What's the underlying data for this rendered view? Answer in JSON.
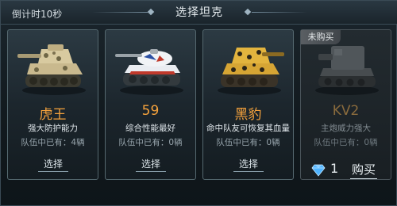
{
  "header": {
    "countdown": "倒计时10秒",
    "title": "选择坦克"
  },
  "cards": [
    {
      "name": "虎王",
      "desc": "强大防护能力",
      "count_label": "队伍中已有：",
      "count_value": "4辆",
      "action_label": "选择",
      "icon": "tiger-tank"
    },
    {
      "name": "59",
      "desc": "综合性能最好",
      "count_label": "队伍中已有：",
      "count_value": "0辆",
      "action_label": "选择",
      "icon": "type59-tank"
    },
    {
      "name": "黑豹",
      "desc": "命中队友可恢复其血量",
      "count_label": "队伍中已有：",
      "count_value": "0辆",
      "action_label": "选择",
      "icon": "panther-tank"
    },
    {
      "name": "KV2",
      "desc": "主炮威力强大",
      "count_label": "队伍中已有：",
      "count_value": "0辆",
      "badge": "未购买",
      "price": "1",
      "buy_label": "购买",
      "icon": "kv2-tank"
    }
  ],
  "colors": {
    "accent_orange": "#f5a23c",
    "gem_blue": "#4fb3ff"
  }
}
